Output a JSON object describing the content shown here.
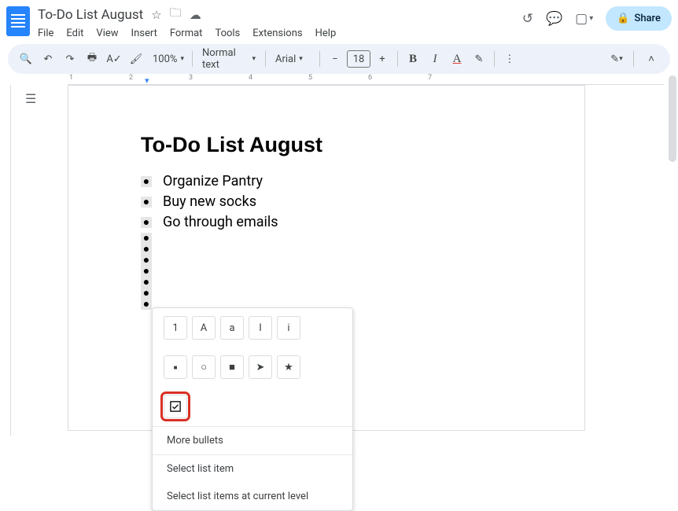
{
  "title": "To-Do List August",
  "menu": [
    "File",
    "Edit",
    "View",
    "Insert",
    "Format",
    "Tools",
    "Extensions",
    "Help"
  ],
  "share_label": "Share",
  "toolbar": {
    "zoom": "100%",
    "style": "Normal text",
    "font": "Arial",
    "size": "18"
  },
  "ruler_marks": [
    "1",
    "2",
    "3",
    "4",
    "5",
    "6",
    "7"
  ],
  "doc": {
    "heading": "To-Do List August",
    "items": [
      "Organize Pantry",
      "Buy new socks",
      "Go through emails"
    ]
  },
  "context_menu": {
    "row1": [
      "1",
      "A",
      "a",
      "I",
      "i"
    ],
    "row2": [
      "■",
      "○",
      "■",
      "➤",
      "★"
    ],
    "more": "More bullets",
    "select_item": "Select list item",
    "select_level": "Select list items at current level"
  }
}
